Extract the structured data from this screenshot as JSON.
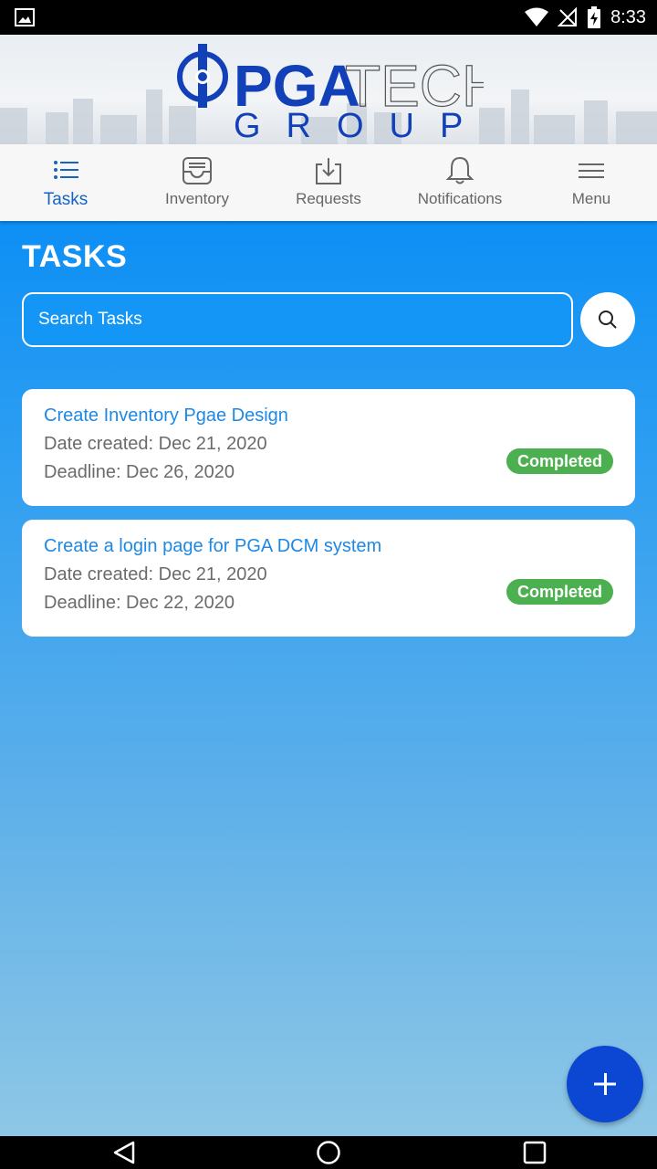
{
  "status_bar": {
    "time": "8:33",
    "icons": [
      "image-icon",
      "wifi-icon",
      "no-signal-icon",
      "battery-charging-icon"
    ]
  },
  "header": {
    "logo": {
      "text_main": "PGA",
      "text_secondary": "TECH",
      "text_sub": "GROUP"
    }
  },
  "nav": {
    "items": [
      {
        "label": "Tasks",
        "icon": "list-icon",
        "active": true
      },
      {
        "label": "Inventory",
        "icon": "inbox-icon",
        "active": false
      },
      {
        "label": "Requests",
        "icon": "download-icon",
        "active": false
      },
      {
        "label": "Notifications",
        "icon": "bell-icon",
        "active": false
      },
      {
        "label": "Menu",
        "icon": "hamburger-icon",
        "active": false
      }
    ],
    "active_color": "#1565c0"
  },
  "main": {
    "title": "TASKS",
    "search": {
      "placeholder": "Search Tasks",
      "value": ""
    },
    "tasks": [
      {
        "title": "Create Inventory Pgae Design",
        "date_created": "Date created: Dec 21, 2020",
        "deadline": "Deadline: Dec 26, 2020",
        "status": "Completed"
      },
      {
        "title": "Create a login page for PGA DCM system",
        "date_created": "Date created: Dec 21, 2020",
        "deadline": "Deadline: Dec 22, 2020",
        "status": "Completed"
      }
    ],
    "fab_icon": "plus-icon"
  },
  "colors": {
    "primary": "#0d8ff5",
    "link": "#1e88e5",
    "status_completed": "#4caf50",
    "fab": "#0b47d3"
  },
  "system_nav": {
    "icons": [
      "back-icon",
      "home-icon",
      "recents-icon"
    ]
  }
}
